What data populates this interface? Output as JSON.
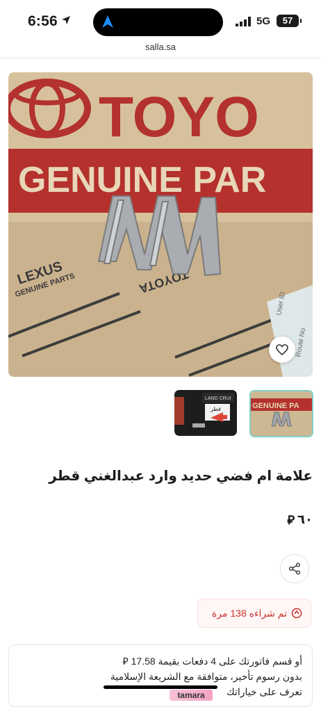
{
  "status_bar": {
    "time": "6:56",
    "network": "5G",
    "battery": "57"
  },
  "browser": {
    "url": "salla.sa"
  },
  "product": {
    "title": "علامة ام فضي حديد وارد عبدالغني قطر",
    "price": "٦٠",
    "currency_symbol": "⃁",
    "sold_text": "تم شراءه 138 مرة"
  },
  "installments": {
    "line1": "أو قسم فاتورتك على 4 دفعات بقيمة 17.58 ⃁",
    "line2": "بدون رسوم تأخير، متوافقة مع الشريعة الإسلامية",
    "line3": "تعرف على خياراتك",
    "provider": "tamara"
  },
  "image_text": {
    "brand_main": "TOYO",
    "brand_sub": "GENUINE PAR",
    "lexus_text": "LEXUS",
    "lexus_sub": "GENUINE PARTS",
    "box_toyota": "TOYOTA",
    "label_user": "User ID",
    "label_route": "Route No",
    "thumb1_text": "LAND CRUI",
    "thumb1_plate": "قطر",
    "thumb2_text": "GENUINE PA"
  },
  "colors": {
    "accent_red": "#c9302c",
    "thumb_border": "#7fd0c8"
  }
}
